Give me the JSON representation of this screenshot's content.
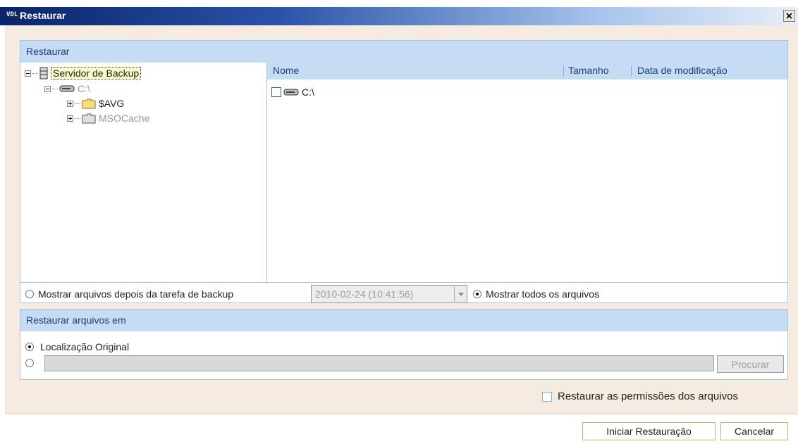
{
  "window": {
    "app_logo": "VDL",
    "title": "Restaurar"
  },
  "restore_panel": {
    "header": "Restaurar",
    "tree": {
      "root": "Servidor de Backup",
      "drive": "C:\\",
      "folders": [
        "$AVG",
        "MSOCache"
      ]
    },
    "columns": {
      "name": "Nome",
      "size": "Tamanho",
      "modified": "Data de modificação"
    },
    "files": [
      {
        "name": "C:\\",
        "checked": false
      }
    ],
    "filter": {
      "option_after_backup": "Mostrar arquivos depois da tarefa de backup",
      "backup_date": "2010-02-24 (10:41:56)",
      "option_all": "Mostrar todos os arquivos",
      "selected": "all"
    }
  },
  "restore_to_panel": {
    "header": "Restaurar arquivos  em",
    "option_original": "Localização Original",
    "custom_path": "",
    "browse_label": "Procurar",
    "selected": "original"
  },
  "permissions_label": "Restaurar as permissões dos arquivos",
  "buttons": {
    "start": "Iniciar Restauração",
    "cancel": "Cancelar"
  }
}
